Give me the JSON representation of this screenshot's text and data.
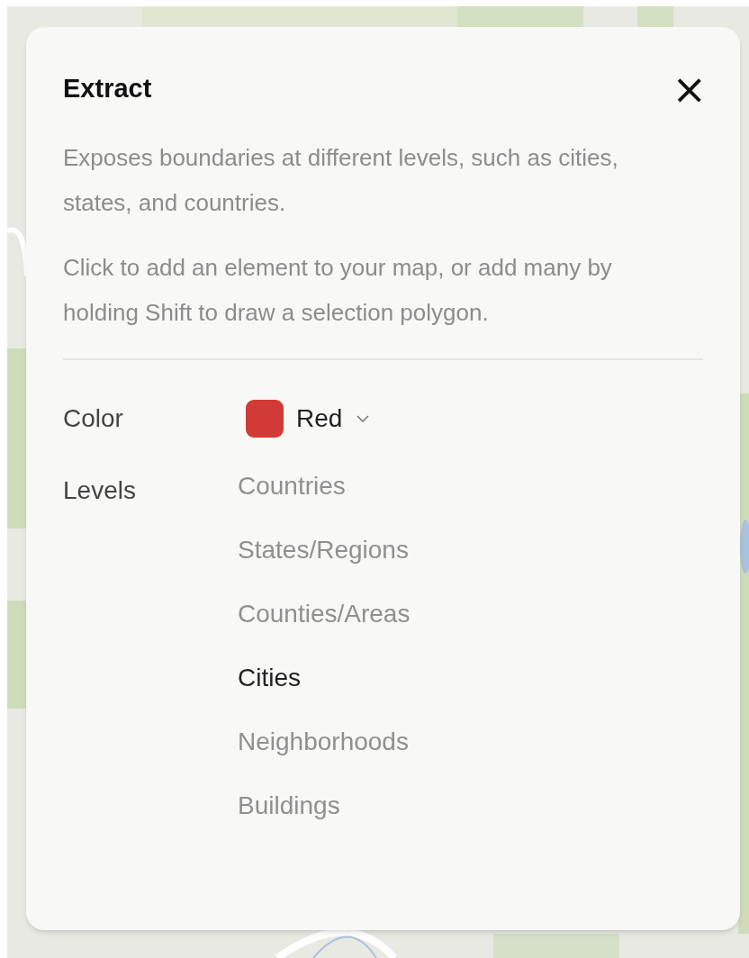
{
  "panel": {
    "title": "Extract",
    "close": "×",
    "paragraphs": [
      "Exposes boundaries at different levels, such as cities, states, and countries.",
      "Click to add an element to your map, or add many by holding Shift to draw a selection polygon."
    ],
    "color": {
      "label": "Color",
      "value": "Red",
      "color": "#d23a35"
    },
    "levels": {
      "label": "Levels",
      "items": [
        {
          "label": "Countries",
          "selected": false
        },
        {
          "label": "States/Regions",
          "selected": false
        },
        {
          "label": "Counties/Areas",
          "selected": false
        },
        {
          "label": "Cities",
          "selected": true
        },
        {
          "label": "Neighborhoods",
          "selected": false
        },
        {
          "label": "Buildings",
          "selected": false
        }
      ]
    }
  }
}
